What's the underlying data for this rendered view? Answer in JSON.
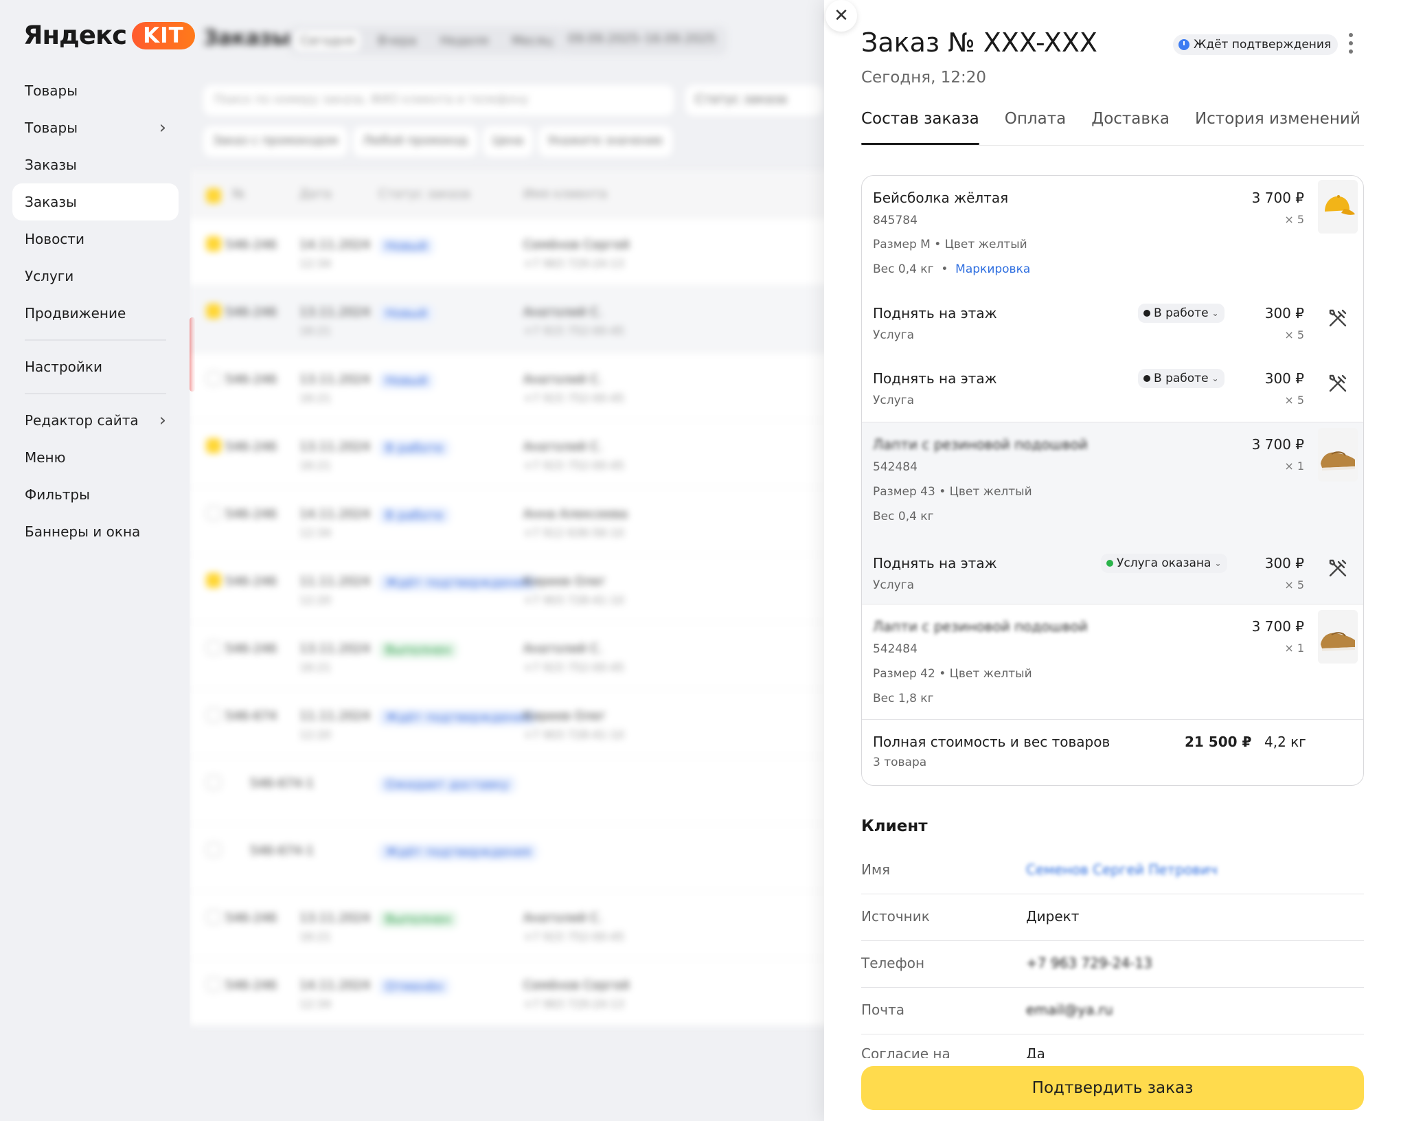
{
  "sidebar": {
    "logo_text": "Яндекс",
    "logo_badge": "KIT",
    "items": [
      {
        "label": "Товары",
        "chevron": false,
        "active": false
      },
      {
        "label": "Товары",
        "chevron": true,
        "active": false
      },
      {
        "label": "Заказы",
        "chevron": false,
        "active": false
      },
      {
        "label": "Заказы",
        "chevron": false,
        "active": true
      },
      {
        "label": "Новости",
        "chevron": false,
        "active": false
      },
      {
        "label": "Услуги",
        "chevron": false,
        "active": false
      },
      {
        "label": "Продвижение",
        "chevron": false,
        "active": false
      },
      {
        "label": "Настройки",
        "chevron": false,
        "active": false
      },
      {
        "label": "Редактор сайта",
        "chevron": true,
        "active": false
      },
      {
        "label": "Меню",
        "chevron": false,
        "active": false
      },
      {
        "label": "Фильтры",
        "chevron": false,
        "active": false
      },
      {
        "label": "Баннеры и окна",
        "chevron": false,
        "active": false
      }
    ]
  },
  "main": {
    "title": "Заказы",
    "periods": [
      "Сегодня",
      "Вчера",
      "Неделя",
      "Месяц"
    ],
    "date_range": "09.09.2025–16.09.2025",
    "search_placeholder": "Поиск по номеру заказа, ФИО клиента и телефону",
    "status_filter": "Статус заказа",
    "filters": [
      "Заказ с промокодом",
      "Любой промокод",
      "Цена",
      "Укажите значение"
    ],
    "columns": [
      "№",
      "Дата",
      "Статус заказа",
      "Имя клиента"
    ],
    "rows": [
      {
        "num": "546-246",
        "date": "14.11.2024",
        "time": "12:34",
        "status": "Новый",
        "client": "Семёнов Сергей",
        "phone": "+7 963 729-24-13",
        "checked": true
      },
      {
        "num": "546-246",
        "date": "13.11.2024",
        "time": "16:21",
        "status": "Новый",
        "client": "Анатолий С.",
        "phone": "+7 915 752-00-45",
        "checked": true
      },
      {
        "num": "546-246",
        "date": "13.11.2024",
        "time": "16:21",
        "status": "Новый",
        "client": "Анатолий С.",
        "phone": "+7 915 752-00-45",
        "checked": false
      },
      {
        "num": "546-246",
        "date": "13.11.2024",
        "time": "16:21",
        "status": "В работе",
        "client": "Анатолий С.",
        "phone": "+7 915 752-00-45",
        "checked": true
      },
      {
        "num": "546-246",
        "date": "14.11.2024",
        "time": "12:34",
        "status": "В работе",
        "client": "Анна Алексеева",
        "phone": "+7 912 636-56-10",
        "checked": false
      },
      {
        "num": "546-246",
        "date": "11.11.2024",
        "time": "12:20",
        "status": "Ждёт подтверждения",
        "client": "Киреев Олег",
        "phone": "+7 903 728-41-10",
        "checked": true
      },
      {
        "num": "546-246",
        "date": "13.11.2024",
        "time": "16:21",
        "status": "Выполнен",
        "client": "Анатолий С.",
        "phone": "+7 915 752-00-45",
        "checked": false
      },
      {
        "num": "546-674",
        "date": "11.11.2024",
        "time": "12:20",
        "status": "Ждёт подтверждения",
        "client": "Киреев Олег",
        "phone": "+7 903 728-41-10",
        "checked": false
      },
      {
        "num": "546-674-1",
        "date": "",
        "time": "",
        "status": "Ожидает доставку",
        "client": "",
        "phone": "",
        "checked": false
      },
      {
        "num": "546-674-1",
        "date": "",
        "time": "",
        "status": "Ждёт подтверждения",
        "client": "",
        "phone": "",
        "checked": false
      },
      {
        "num": "546-246",
        "date": "13.11.2024",
        "time": "16:21",
        "status": "Выполнен",
        "client": "Анатолий С.",
        "phone": "+7 915 752-00-45",
        "checked": false
      },
      {
        "num": "546-246",
        "date": "14.11.2024",
        "time": "12:34",
        "status": "Отменён",
        "client": "Семёнов Сергей",
        "phone": "+7 963 729-24-13",
        "checked": false
      }
    ]
  },
  "drawer": {
    "title": "Заказ № XXX-XXX",
    "date": "Сегодня, 12:20",
    "status": "Ждёт подтверждения",
    "tabs": [
      "Состав заказа",
      "Оплата",
      "Доставка",
      "История изменений"
    ],
    "items": {
      "p1": {
        "name": "Бейсболка жёлтая",
        "sku": "845784",
        "attrs": "Размер M • Цвет желтый",
        "weight": "Вес 0,4 кг",
        "link": "Маркировка",
        "price": "3 700 ₽",
        "qty": "× 5"
      },
      "s1": {
        "name": "Поднять на этаж",
        "type": "Услуга",
        "status": "В работе",
        "price": "300 ₽",
        "qty": "× 5"
      },
      "s2": {
        "name": "Поднять на этаж",
        "type": "Услуга",
        "status": "В работе",
        "price": "300 ₽",
        "qty": "× 5"
      },
      "p2": {
        "name": "Лапти с резиновой подошвой",
        "sku": "542484",
        "attrs": "Размер 43 • Цвет желтый",
        "weight": "Вес 0,4 кг",
        "price": "3 700 ₽",
        "qty": "× 1"
      },
      "s3": {
        "name": "Поднять на этаж",
        "type": "Услуга",
        "status": "Услуга оказана",
        "price": "300 ₽",
        "qty": "× 5"
      },
      "p3": {
        "name": "Лапти с резиновой подошвой",
        "sku": "542484",
        "attrs": "Размер 42 • Цвет желтый",
        "weight": "Вес 1,8 кг",
        "price": "3 700 ₽",
        "qty": "× 1"
      }
    },
    "total": {
      "label": "Полная стоимость и вес товаров",
      "count": "3 товара",
      "sum": "21 500 ₽",
      "weight": "4,2 кг"
    },
    "client": {
      "title": "Клиент",
      "rows": [
        {
          "key": "Имя",
          "value": "Семенов Сергей Петрович"
        },
        {
          "key": "Источник",
          "value": "Директ"
        },
        {
          "key": "Телефон",
          "value": "+7 963 729-24-13"
        },
        {
          "key": "Почта",
          "value": "email@ya.ru"
        },
        {
          "key": "Согласие на",
          "value": "Да"
        }
      ]
    },
    "confirm_label": "Подтвердить заказ"
  },
  "colors": {
    "accent": "#ffdb4d",
    "kit": "#ff5b2e",
    "link": "#2f6fe0",
    "status_blue": "#3d7cf2",
    "status_green": "#2ab34a"
  }
}
